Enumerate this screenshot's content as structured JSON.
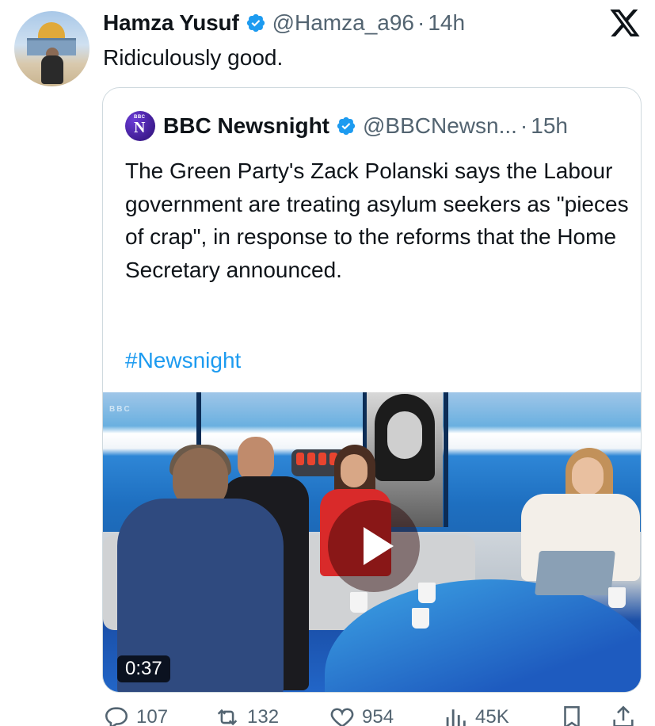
{
  "post": {
    "author_name": "Hamza Yusuf",
    "handle": "@Hamza_a96",
    "separator": "·",
    "time": "14h",
    "text": "Ridiculously good."
  },
  "quote": {
    "author_name": "BBC Newsnight",
    "handle": "@BBCNewsn...",
    "separator": "·",
    "time": "15h",
    "text": "The Green Party's Zack Polanski says the Labour government are treating asylum seekers as \"pieces of crap\", in response to the reforms that the Home Secretary announced.",
    "hashtag": "#Newsnight",
    "avatar_small_text": "BBC",
    "avatar_letter": "N",
    "video": {
      "duration": "0:37",
      "watermark": "BBC"
    }
  },
  "actions": {
    "replies": "107",
    "reposts": "132",
    "likes": "954",
    "views": "45K"
  },
  "colors": {
    "accent": "#1d9bf0",
    "muted": "#536471",
    "border": "#cfd9de"
  },
  "icons": {
    "verified": "verified-badge-icon",
    "platform": "x-logo-icon",
    "reply": "reply-icon",
    "repost": "repost-icon",
    "like": "heart-icon",
    "views": "views-icon",
    "bookmark": "bookmark-icon",
    "share": "share-icon",
    "play": "play-icon"
  }
}
